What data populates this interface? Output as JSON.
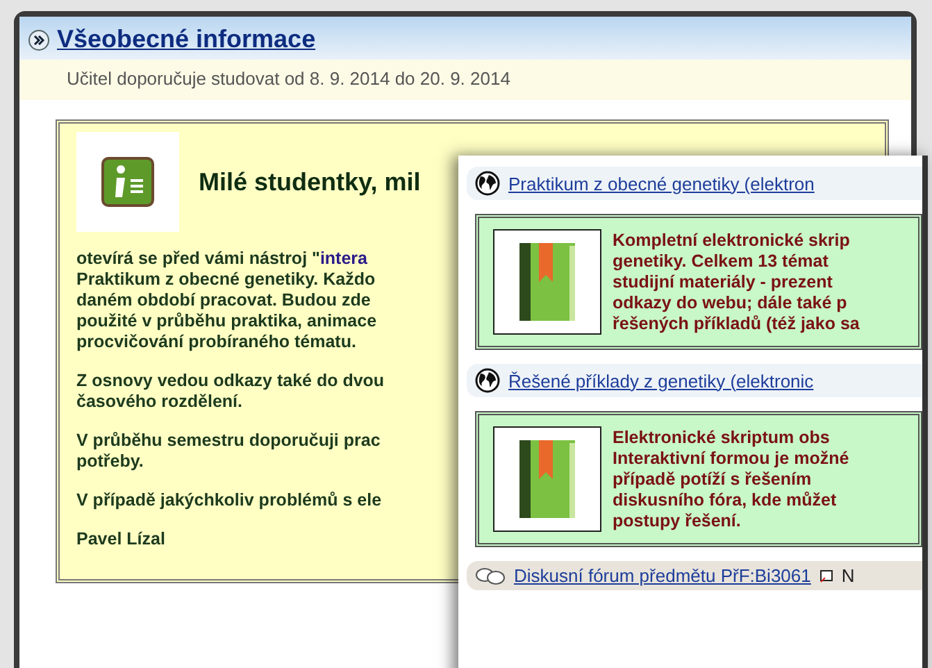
{
  "section": {
    "title": "Všeobecné informace",
    "note": "Učitel doporučuje studovat od 8. 9. 2014 do 20. 9. 2014"
  },
  "welcome": {
    "heading": "Milé studentky, mil",
    "paragraphs": [
      [
        {
          "text": "otevírá se před vámi nástroj \"",
          "link": "intera"
        },
        {
          "text": "Praktikum z obecné genetiky. Každo"
        },
        {
          "text": "daném období pracovat. Budou zde"
        },
        {
          "text": "použité v průběhu praktika, animace"
        },
        {
          "text": "procvičování probíraného tématu."
        }
      ],
      [
        {
          "text": "Z osnovy vedou odkazy také do dvou"
        },
        {
          "text": "časového rozdělení."
        }
      ],
      [
        {
          "text": "V průběhu semestru doporučuji prac"
        },
        {
          "text": "potřeby."
        }
      ],
      [
        {
          "text": "V případě jakýchkoliv problémů s ele"
        }
      ],
      [
        {
          "text": "Pavel Lízal"
        }
      ]
    ]
  },
  "resources": [
    {
      "kind": "resource",
      "title": "Praktikum z obecné genetiky (elektron",
      "lines": [
        "Kompletní elektronické skrip",
        "genetiky. Celkem 13 témat",
        "studijní materiály - prezent",
        "odkazy do webu; dále také p",
        "řešených příkladů (též jako sa"
      ]
    },
    {
      "kind": "resource",
      "title": "Řešené příklady z genetiky (elektronic",
      "lines": [
        "Elektronické skriptum obs",
        "Interaktivní formou je možné",
        "případě potíží s řešením",
        "diskusního fóra, kde můžet",
        "postupy řešení."
      ]
    },
    {
      "kind": "forum",
      "title": "Diskusní fórum předmětu PřF:Bi3061",
      "after": "N"
    }
  ]
}
